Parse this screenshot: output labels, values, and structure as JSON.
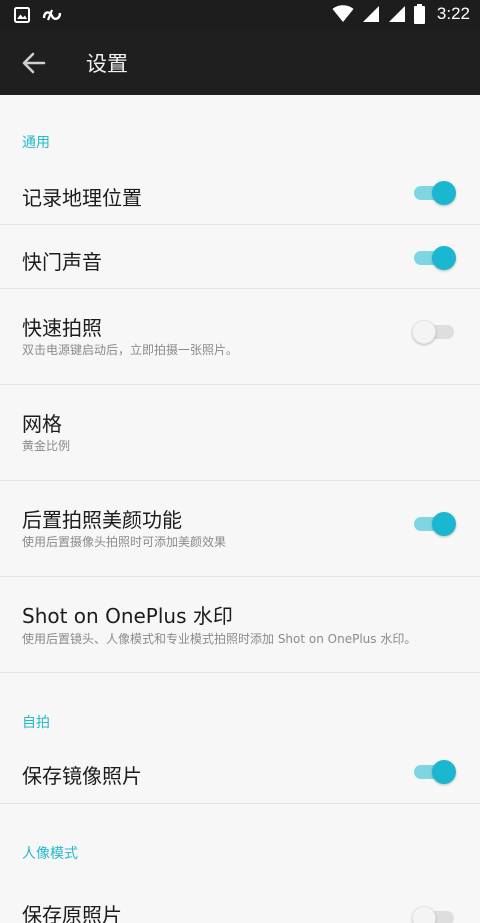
{
  "status_bar": {
    "time": "3:22"
  },
  "toolbar": {
    "title": "设置"
  },
  "sections": {
    "general": "通用",
    "selfie": "自拍",
    "portrait": "人像模式"
  },
  "settings": {
    "location": {
      "label": "记录地理位置",
      "enabled": true
    },
    "shutter_sound": {
      "label": "快门声音",
      "enabled": true
    },
    "quick_capture": {
      "label": "快速拍照",
      "sub": "双击电源键启动后，立即拍摄一张照片。",
      "enabled": false
    },
    "grid": {
      "label": "网格",
      "sub": "黄金比例"
    },
    "rear_beauty": {
      "label": "后置拍照美颜功能",
      "sub": "使用后置摄像头拍照时可添加美颜效果",
      "enabled": true
    },
    "watermark": {
      "label": "Shot on OnePlus 水印",
      "sub": "使用后置镜头、人像模式和专业模式拍照时添加 Shot on OnePlus 水印。"
    },
    "mirror_photo": {
      "label": "保存镜像照片",
      "enabled": true
    },
    "save_original": {
      "label": "保存原照片",
      "enabled": false
    }
  },
  "colors": {
    "accent": "#1bb6cf",
    "toolbar": "#1f1f1f",
    "background": "#f7f7f7"
  }
}
